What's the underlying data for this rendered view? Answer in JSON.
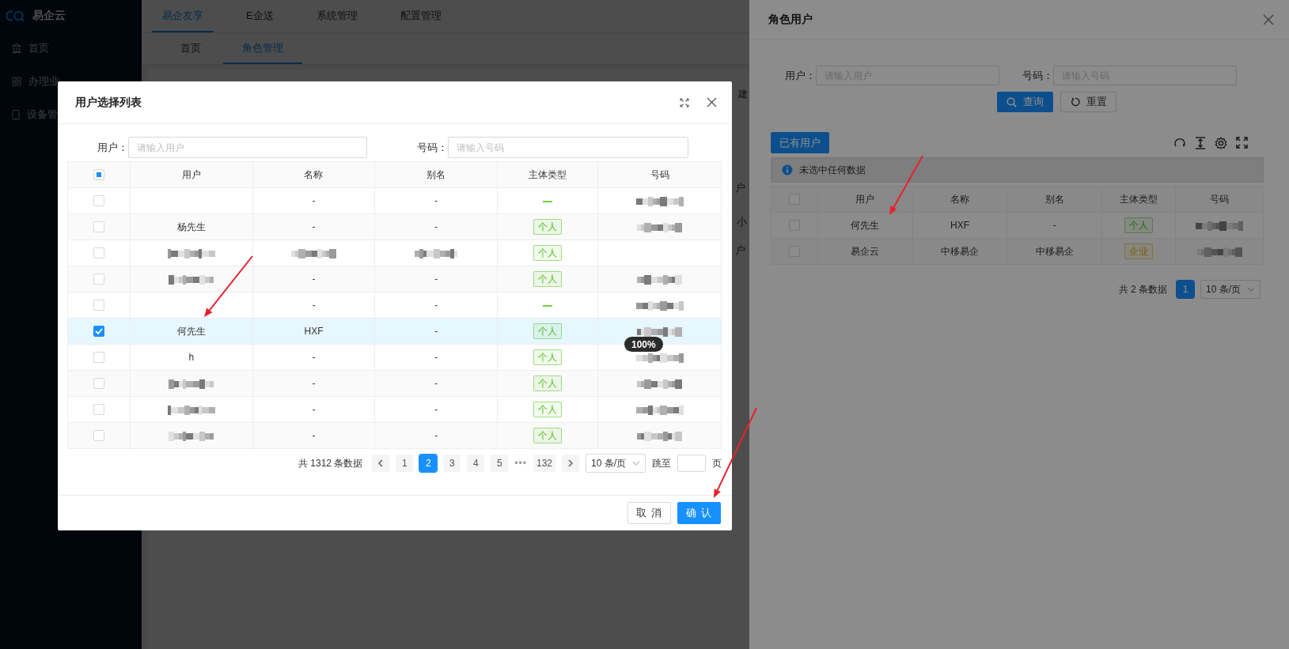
{
  "app": {
    "logo": "易企云"
  },
  "sidebar": {
    "items": [
      {
        "label": "首页"
      },
      {
        "label": "办理业"
      },
      {
        "label": "设备管"
      }
    ]
  },
  "top_tabs": [
    {
      "label": "易企友享",
      "selected": true
    },
    {
      "label": "E企送",
      "selected": false
    },
    {
      "label": "系统管理",
      "selected": false
    },
    {
      "label": "配置管理",
      "selected": false
    }
  ],
  "sub_tabs": [
    {
      "label": "首页",
      "selected": false
    },
    {
      "label": "角色管理",
      "selected": true
    }
  ],
  "background": {
    "button": "建",
    "fragments": [
      "户",
      "小",
      "户"
    ]
  },
  "modal": {
    "title": "用户选择列表",
    "filters": [
      {
        "label": "用户：",
        "placeholder": "请输入用户"
      },
      {
        "label": "号码：",
        "placeholder": "请输入号码"
      }
    ],
    "table": {
      "select_all": {
        "indeterminate": true
      },
      "columns": [
        "用户",
        "名称",
        "别名",
        "主体类型",
        "号码"
      ],
      "rows": [
        {
          "checked": false,
          "cells": [
            null,
            "-",
            "-",
            {
              "kind": "dash",
              "color": "#73d13d"
            },
            {
              "blurred": true
            }
          ]
        },
        {
          "checked": false,
          "cells": [
            "杨先生",
            "-",
            "-",
            {
              "kind": "tag",
              "label": "个人",
              "color": "#52c41a"
            },
            {
              "blurred": true
            }
          ]
        },
        {
          "checked": false,
          "cells": [
            {
              "blurred": true
            },
            {
              "blurred": true
            },
            {
              "blurred": true
            },
            {
              "kind": "tag",
              "label": "个人",
              "color": "#52c41a"
            },
            null
          ]
        },
        {
          "checked": false,
          "cells": [
            {
              "blurred": true
            },
            "-",
            "-",
            {
              "kind": "tag",
              "label": "个人",
              "color": "#52c41a"
            },
            {
              "blurred": true
            }
          ]
        },
        {
          "checked": false,
          "cells": [
            null,
            "-",
            "-",
            {
              "kind": "dash",
              "color": "#73d13d"
            },
            {
              "blurred": true
            }
          ]
        },
        {
          "checked": true,
          "cells": [
            "何先生",
            "HXF",
            "-",
            {
              "kind": "tag",
              "label": "个人",
              "color": "#52c41a"
            },
            {
              "blurred": true
            }
          ]
        },
        {
          "checked": false,
          "cells": [
            "h",
            "-",
            "-",
            {
              "kind": "tag",
              "label": "个人",
              "color": "#52c41a"
            },
            {
              "blurred": true
            }
          ]
        },
        {
          "checked": false,
          "cells": [
            {
              "blurred": true
            },
            "-",
            "-",
            {
              "kind": "tag",
              "label": "个人",
              "color": "#52c41a"
            },
            {
              "blurred": true
            }
          ]
        },
        {
          "checked": false,
          "cells": [
            {
              "blurred": true
            },
            "-",
            "-",
            {
              "kind": "tag",
              "label": "个人",
              "color": "#52c41a"
            },
            {
              "blurred": true
            }
          ]
        },
        {
          "checked": false,
          "cells": [
            {
              "blurred": true
            },
            "-",
            "-",
            {
              "kind": "tag",
              "label": "个人",
              "color": "#52c41a"
            },
            {
              "blurred": true
            }
          ]
        }
      ]
    },
    "pagination": {
      "total": "共 1312 条数据",
      "pages": [
        {
          "label": "1",
          "selected": false
        },
        {
          "label": "2",
          "selected": true
        },
        {
          "label": "3",
          "selected": false
        },
        {
          "label": "4",
          "selected": false
        },
        {
          "label": "5",
          "selected": false
        },
        {
          "label": "•••",
          "kind": "ellipsis"
        },
        {
          "label": "132",
          "selected": false
        }
      ],
      "page_size": "10 条/页",
      "jump_label": "跳至",
      "jump_suffix": "页"
    },
    "buttons": [
      {
        "label": "取 消",
        "kind": "default"
      },
      {
        "label": "确 认",
        "kind": "primary"
      }
    ]
  },
  "zoom_badge": "100%",
  "drawer": {
    "title": "角色用户",
    "filters": [
      {
        "label": "用户：",
        "placeholder": "请输入用户"
      },
      {
        "label": "号码：",
        "placeholder": "请输入号码"
      }
    ],
    "buttons": [
      {
        "label": "查询",
        "kind": "primary"
      },
      {
        "label": "重置",
        "kind": "default"
      }
    ],
    "add_button": "已有用户",
    "alert": "未选中任何数据",
    "table": {
      "select_all": {
        "indeterminate": false
      },
      "columns": [
        "用户",
        "名称",
        "别名",
        "主体类型",
        "号码"
      ],
      "rows": [
        {
          "checked": false,
          "cells": [
            "何先生",
            "HXF",
            "-",
            {
              "kind": "success",
              "label": "个人"
            },
            {
              "blurred": true
            }
          ]
        },
        {
          "checked": false,
          "cells": [
            "易企云",
            "中移易企",
            "中移易企",
            {
              "kind": "warning",
              "label": "企业"
            },
            {
              "blurred": true
            }
          ]
        }
      ]
    },
    "pagination": {
      "total": "共 2 条数据",
      "pages": [
        {
          "label": "1",
          "selected": true
        }
      ],
      "page_size": "10 条/页"
    }
  }
}
